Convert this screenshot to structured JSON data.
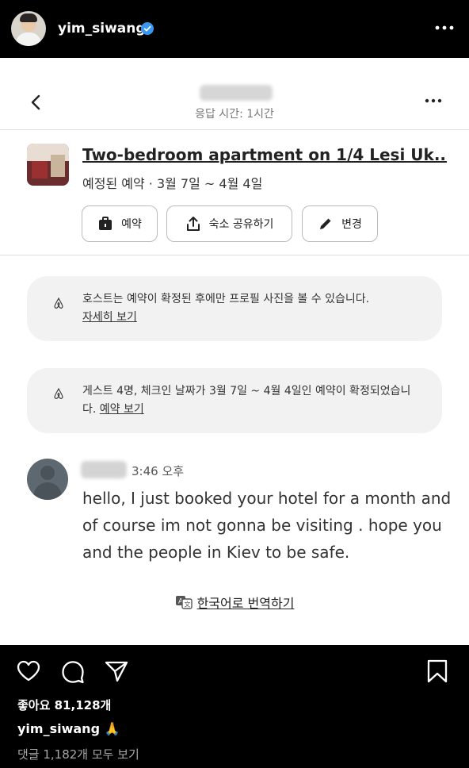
{
  "post": {
    "username": "yim_siwang",
    "caption_emoji": "🙏",
    "likes_text": "좋아요 81,128개",
    "comments_link": "댓글 1,182개 모두 보기",
    "more_icon": "more-horizontal-icon"
  },
  "chat": {
    "response_time": "응답 시간: 1시간",
    "listing": {
      "title": "Two-bedroom apartment on 1/4 Lesi Uk...",
      "subtitle": "예정된 예약 · 3월 7일 ~ 4월 4일"
    },
    "buttons": {
      "reservation": "예약",
      "share": "숙소 공유하기",
      "change": "변경"
    },
    "notices": [
      {
        "text": "호스트는 예약이 확정된 후에만 프로필 사진을 볼 수 있습니다.",
        "link": "자세히 보기"
      },
      {
        "text": "게스트 4명, 체크인 날짜가 3월 7일 ~ 4월 4일인 예약이 확정되었습니다.",
        "link": "예약 보기"
      }
    ],
    "message": {
      "time": "3:46 오후",
      "text": "hello, I just booked your hotel for a month and of course im not gonna be visiting . hope you and the people in Kiev to be safe."
    },
    "translate_label": "한국어로 번역하기"
  },
  "colors": {
    "background": "#000000",
    "chat_bg": "#ffffff",
    "notice_bg": "#f2f2f2",
    "verified": "#3897f0"
  }
}
